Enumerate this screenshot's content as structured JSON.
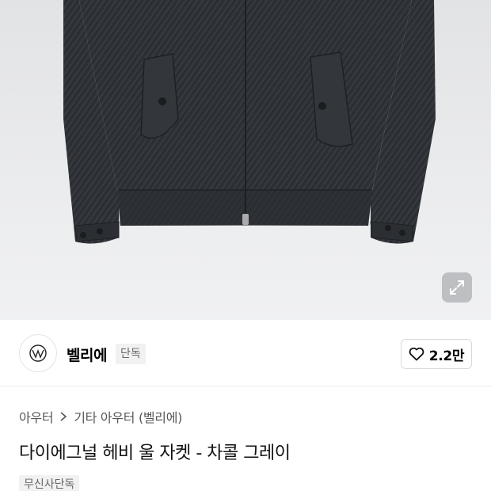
{
  "brand": {
    "name": "벨리에",
    "exclusive_label": "단독",
    "like_count": "2.2만"
  },
  "breadcrumb": {
    "category": "아우터",
    "subcategory": "기타 아우터 (벨리에)"
  },
  "product": {
    "title": "다이에그널 헤비 울 자켓 - 차콜 그레이",
    "store_badge": "무신사단독"
  },
  "icons": {
    "zoom": "expand-icon",
    "like": "heart-icon",
    "breadcrumb_separator": "chevron-right-icon",
    "brand_logo": "brand-logo-icon"
  },
  "colors": {
    "image_background": "#e8e9eb",
    "jacket": "#2e3136",
    "badge_background": "#f1f1f1"
  }
}
